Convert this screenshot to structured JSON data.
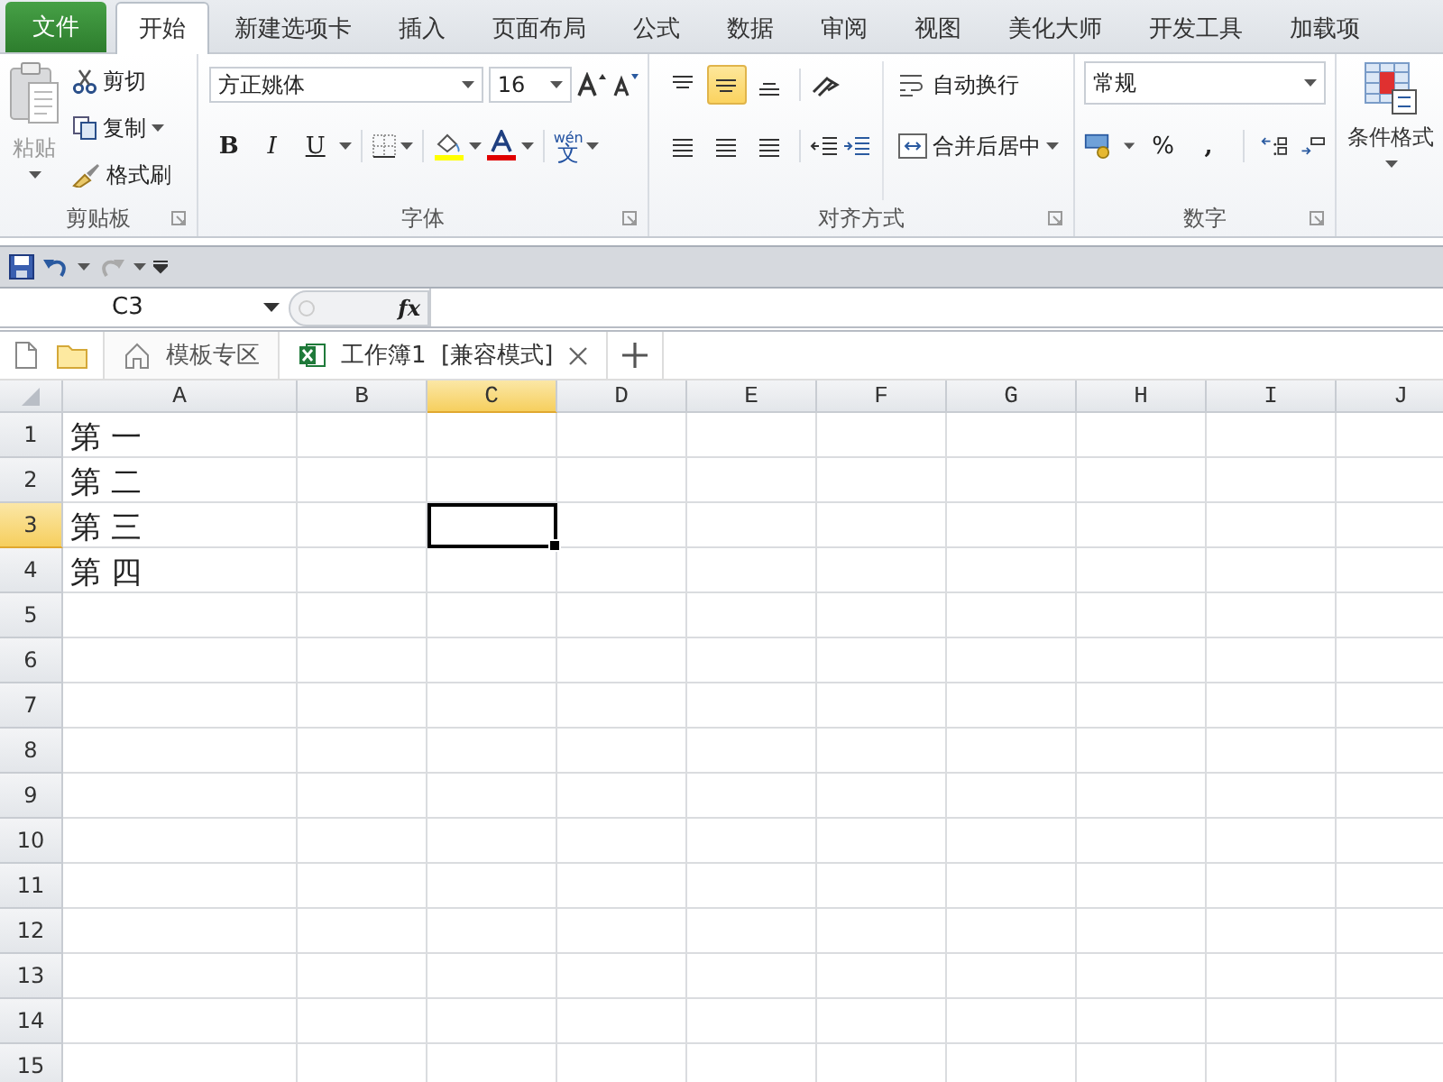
{
  "menu_tabs": [
    {
      "label": "文件",
      "kind": "file",
      "selected": false
    },
    {
      "label": "开始",
      "kind": "tab",
      "selected": true
    },
    {
      "label": "新建选项卡",
      "kind": "tab",
      "selected": false
    },
    {
      "label": "插入",
      "kind": "tab",
      "selected": false
    },
    {
      "label": "页面布局",
      "kind": "tab",
      "selected": false
    },
    {
      "label": "公式",
      "kind": "tab",
      "selected": false
    },
    {
      "label": "数据",
      "kind": "tab",
      "selected": false
    },
    {
      "label": "审阅",
      "kind": "tab",
      "selected": false
    },
    {
      "label": "视图",
      "kind": "tab",
      "selected": false
    },
    {
      "label": "美化大师",
      "kind": "tab",
      "selected": false
    },
    {
      "label": "开发工具",
      "kind": "tab",
      "selected": false
    },
    {
      "label": "加载项",
      "kind": "tab",
      "selected": false
    }
  ],
  "ribbon": {
    "clipboard": {
      "title": "剪贴板",
      "paste": "粘贴",
      "cut": "剪切",
      "copy": "复制",
      "format_painter": "格式刷"
    },
    "font": {
      "title": "字体",
      "font_name": "方正姚体",
      "font_size": "16",
      "bold": "B",
      "italic": "I",
      "underline": "U",
      "phonetic_top": "wén",
      "phonetic_bottom": "文"
    },
    "alignment": {
      "title": "对齐方式",
      "vertical_align": [
        {
          "kind": "top",
          "selected": false
        },
        {
          "kind": "middle",
          "selected": true
        },
        {
          "kind": "bottom",
          "selected": false
        }
      ],
      "wrap_text": "自动换行",
      "merge_center": "合并后居中"
    },
    "number": {
      "title": "数字",
      "format": "常规",
      "percent": "%",
      "comma": ","
    },
    "styles": {
      "conditional_format": "条件格式"
    }
  },
  "formula_bar": {
    "name_box": "C3",
    "fx": "fx"
  },
  "doc_tabs": [
    {
      "label": "模板专区",
      "kind": "home",
      "selected": false
    },
    {
      "label": "工作簿1  [兼容模式]",
      "kind": "workbook",
      "selected": true
    }
  ],
  "sheet": {
    "columns": [
      {
        "label": "A",
        "selected": false
      },
      {
        "label": "B",
        "selected": false
      },
      {
        "label": "C",
        "selected": true
      },
      {
        "label": "D",
        "selected": false
      },
      {
        "label": "E",
        "selected": false
      },
      {
        "label": "F",
        "selected": false
      },
      {
        "label": "G",
        "selected": false
      },
      {
        "label": "H",
        "selected": false
      },
      {
        "label": "I",
        "selected": false
      },
      {
        "label": "J",
        "selected": false
      }
    ],
    "rows": [
      {
        "label": "1",
        "selected": false,
        "cells": [
          "第 一"
        ]
      },
      {
        "label": "2",
        "selected": false,
        "cells": [
          "第 二"
        ]
      },
      {
        "label": "3",
        "selected": true,
        "cells": [
          "第 三"
        ]
      },
      {
        "label": "4",
        "selected": false,
        "cells": [
          "第 四"
        ]
      },
      {
        "label": "5",
        "selected": false,
        "cells": []
      },
      {
        "label": "6",
        "selected": false,
        "cells": []
      },
      {
        "label": "7",
        "selected": false,
        "cells": []
      },
      {
        "label": "8",
        "selected": false,
        "cells": []
      },
      {
        "label": "9",
        "selected": false,
        "cells": []
      },
      {
        "label": "10",
        "selected": false,
        "cells": []
      },
      {
        "label": "11",
        "selected": false,
        "cells": []
      },
      {
        "label": "12",
        "selected": false,
        "cells": []
      },
      {
        "label": "13",
        "selected": false,
        "cells": []
      },
      {
        "label": "14",
        "selected": false,
        "cells": []
      },
      {
        "label": "15",
        "selected": false,
        "cells": []
      }
    ]
  }
}
